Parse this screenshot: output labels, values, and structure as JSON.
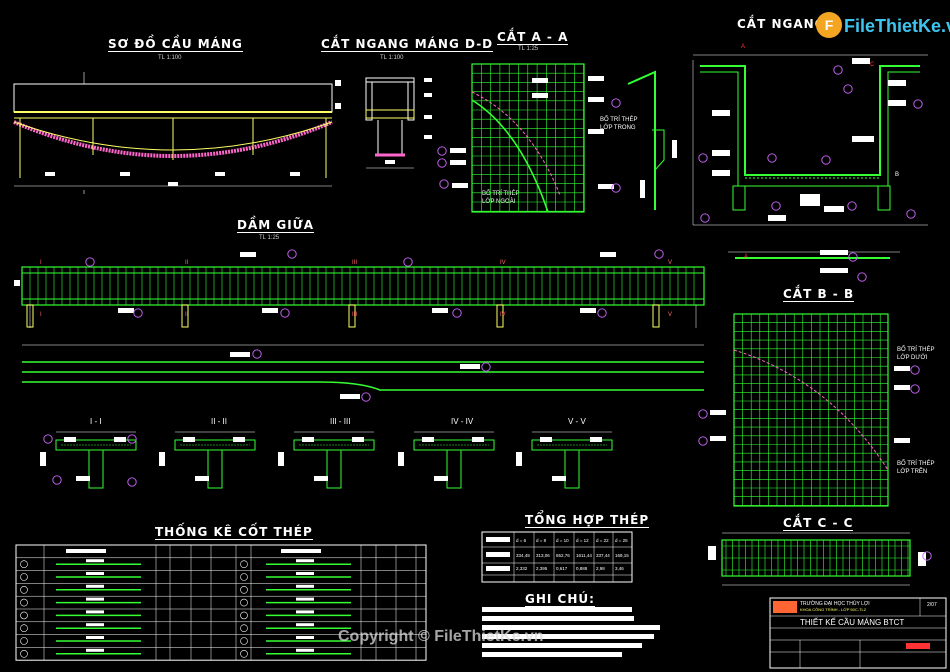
{
  "titles": {
    "so_do": "SƠ ĐỒ CẦU MÁNG",
    "cat_ngang_dd": "CẮT NGANG MÁNG D-D",
    "cat_aa": "CẮT A - A",
    "cat_ngang": "CẮT NGANG",
    "dam_giua": "DẦM GIỮA",
    "cat_bb": "CẮT B - B",
    "thong_ke": "THỐNG KÊ CỐT THÉP",
    "tong_hop": "TỔNG HỢP THÉP",
    "ghi_chu": "GHI CHÚ:",
    "cat_cc": "CẮT C - C"
  },
  "scales": {
    "so_do": "TL 1:100",
    "dd": "TL 1:100",
    "aa": "TL 1:25",
    "dam": "TL 1:25"
  },
  "notes": {
    "lop_trong": "BỐ TRÍ THÉP\nLỚP TRONG",
    "lop_ngoai": "BỐ TRÍ THÉP\nLỚP NGOÀI",
    "lop_duoi": "BỐ TRÍ THÉP\nLỚP DƯỚI",
    "lop_tren": "BỐ TRÍ THÉP\nLỚP TRÊN"
  },
  "section_labels": {
    "s1": "I - I",
    "s2": "II - II",
    "s3": "III - III",
    "s4": "IV - IV",
    "s5": "V - V"
  },
  "section_marks": [
    "I",
    "II",
    "III",
    "IV",
    "V"
  ],
  "tong_hop_headers": [
    "d = 6",
    "d = 8",
    "d = 10",
    "d = 12",
    "d = 22",
    "d = 25"
  ],
  "tong_hop_rows": [
    [
      "334,49",
      "313,06",
      "652,76",
      "1611,44",
      "337,44",
      "169,15"
    ],
    [
      "2,332",
      "2,395",
      "0,617",
      "0,888",
      "2,98",
      "3,46"
    ]
  ],
  "title_block": {
    "school": "TRƯỜNG ĐẠI HỌC THỦY LỢI",
    "faculty": "KHOA CÔNG TRÌNH - LỚP 50C-TL2",
    "drawing_title": "THIẾT KẾ CẦU MÁNG BTCT",
    "sheet": "2/07"
  },
  "watermark": "Copyright © FileThietKe.vn",
  "logo": "FileThietKe.vn",
  "colors": {
    "rebar": "#33ff33",
    "concrete": "#ffff66",
    "dim": "#ffffff",
    "tag": "#cc66ff",
    "hatch": "#ff66cc"
  }
}
